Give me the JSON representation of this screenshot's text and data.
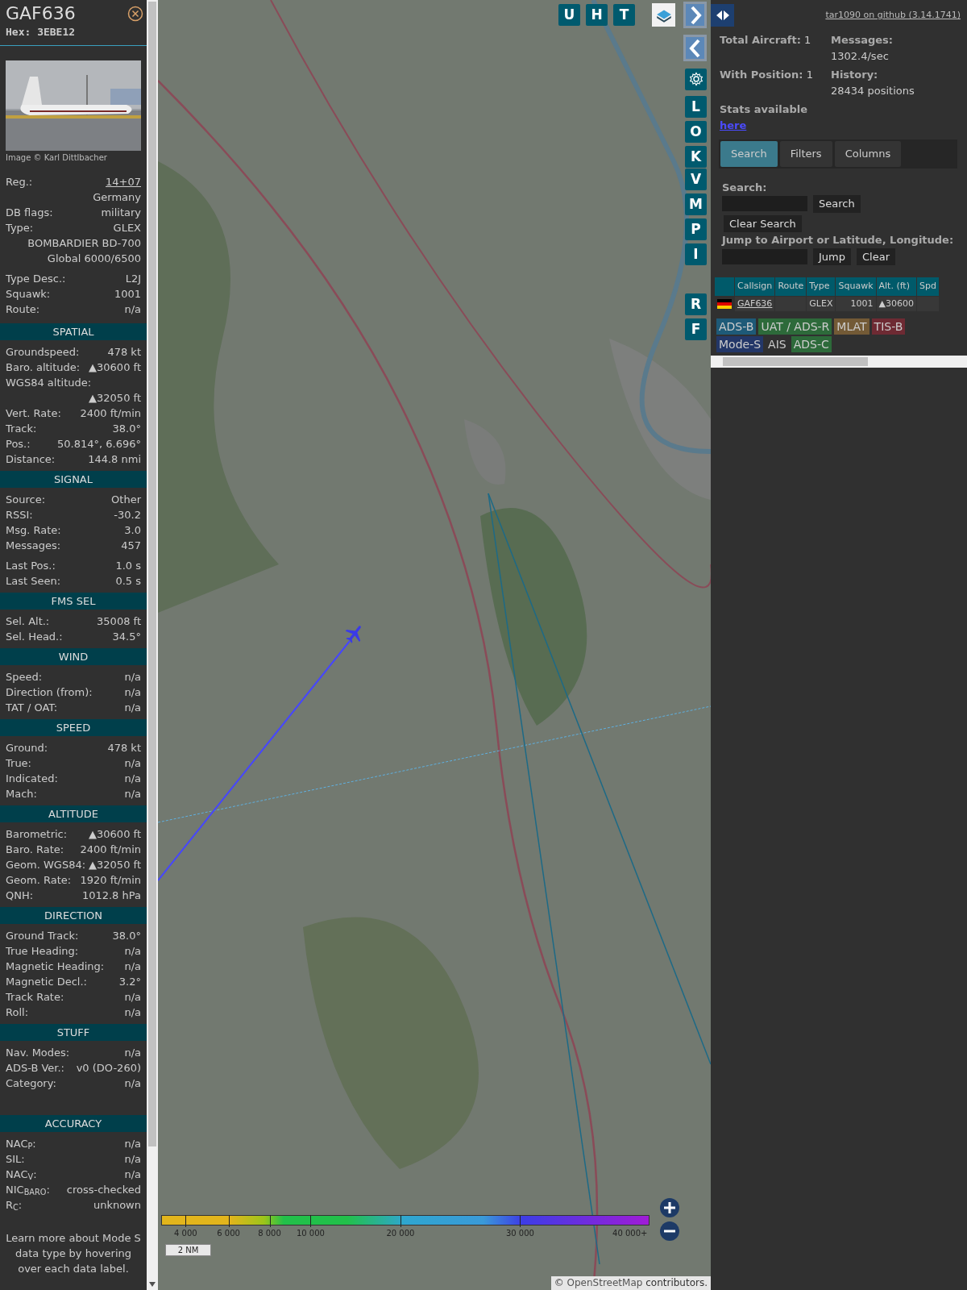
{
  "sidebar": {
    "callsign": "GAF636",
    "hex_label": "Hex:",
    "hex": "3EBE12",
    "photo": {
      "kind": "picture",
      "credit": "Image © Karl Dittlbacher"
    },
    "details": [
      [
        {
          "kind": "pair",
          "label": "Reg.:",
          "value": "14+07",
          "link": true
        },
        {
          "kind": "value",
          "value": "Germany"
        },
        {
          "kind": "pair",
          "label": "DB flags:",
          "value": "military"
        },
        {
          "kind": "pair",
          "label": "Type:",
          "value": "GLEX"
        },
        {
          "kind": "value",
          "value": "BOMBARDIER BD-700 Global 6000/6500"
        }
      ],
      [
        {
          "kind": "pair",
          "label": "Type Desc.:",
          "value": "L2J"
        },
        {
          "kind": "pair",
          "label": "Squawk:",
          "value": "1001"
        },
        {
          "kind": "pair",
          "label": "Route:",
          "value": "n/a"
        }
      ]
    ],
    "sections": [
      {
        "title": "SPATIAL",
        "groups": [
          [
            {
              "kind": "pair",
              "label": "Groundspeed:",
              "value": "478 kt"
            },
            {
              "kind": "pair",
              "label": "Baro. altitude:",
              "value": "▲30600 ft"
            },
            {
              "kind": "wrap",
              "label": "WGS84 altitude:",
              "value": "▲32050 ft"
            },
            {
              "kind": "pair",
              "label": "Vert. Rate:",
              "value": "2400 ft/min"
            },
            {
              "kind": "pair",
              "label": "Track:",
              "value": "38.0°"
            },
            {
              "kind": "pair",
              "label": "Pos.:",
              "value": "50.814°, 6.696°"
            },
            {
              "kind": "pair",
              "label": "Distance:",
              "value": "144.8 nmi"
            }
          ]
        ]
      },
      {
        "title": "SIGNAL",
        "groups": [
          [
            {
              "kind": "pair",
              "label": "Source:",
              "value": "Other"
            },
            {
              "kind": "pair",
              "label": "RSSI:",
              "value": "-30.2"
            },
            {
              "kind": "pair",
              "label": "Msg. Rate:",
              "value": "3.0"
            },
            {
              "kind": "pair",
              "label": "Messages:",
              "value": "457"
            }
          ],
          [
            {
              "kind": "pair",
              "label": "Last Pos.:",
              "value": "1.0 s"
            },
            {
              "kind": "pair",
              "label": "Last Seen:",
              "value": "0.5 s"
            }
          ]
        ]
      },
      {
        "title": "FMS SEL",
        "groups": [
          [
            {
              "kind": "pair",
              "label": "Sel. Alt.:",
              "value": "35008 ft"
            },
            {
              "kind": "pair",
              "label": "Sel. Head.:",
              "value": "34.5°"
            }
          ]
        ]
      },
      {
        "title": "WIND",
        "groups": [
          [
            {
              "kind": "pair",
              "label": "Speed:",
              "value": "n/a"
            },
            {
              "kind": "pair",
              "label": "Direction (from):",
              "value": "n/a"
            },
            {
              "kind": "pair",
              "label": "TAT / OAT:",
              "value": "n/a"
            }
          ]
        ]
      },
      {
        "title": "SPEED",
        "groups": [
          [
            {
              "kind": "pair",
              "label": "Ground:",
              "value": "478 kt"
            },
            {
              "kind": "pair",
              "label": "True:",
              "value": "n/a"
            },
            {
              "kind": "pair",
              "label": "Indicated:",
              "value": "n/a"
            },
            {
              "kind": "pair",
              "label": "Mach:",
              "value": "n/a"
            }
          ]
        ]
      },
      {
        "title": "ALTITUDE",
        "groups": [
          [
            {
              "kind": "pair",
              "label": "Barometric:",
              "value": "▲30600 ft"
            },
            {
              "kind": "pair",
              "label": "Baro. Rate:",
              "value": "2400 ft/min"
            },
            {
              "kind": "pair",
              "label": "Geom. WGS84:",
              "value": "▲32050 ft"
            },
            {
              "kind": "pair",
              "label": "Geom. Rate:",
              "value": "1920 ft/min"
            },
            {
              "kind": "pair",
              "label": "QNH:",
              "value": "1012.8 hPa"
            }
          ]
        ]
      },
      {
        "title": "DIRECTION",
        "groups": [
          [
            {
              "kind": "pair",
              "label": "Ground Track:",
              "value": "38.0°"
            },
            {
              "kind": "pair",
              "label": "True Heading:",
              "value": "n/a"
            },
            {
              "kind": "pair",
              "label": "Magnetic Heading:",
              "value": "n/a"
            },
            {
              "kind": "pair",
              "label": "Magnetic Decl.:",
              "value": "3.2°"
            },
            {
              "kind": "pair",
              "label": "Track Rate:",
              "value": "n/a"
            },
            {
              "kind": "pair",
              "label": "Roll:",
              "value": "n/a"
            }
          ]
        ]
      },
      {
        "title": "STUFF",
        "groups": [
          [
            {
              "kind": "pair",
              "label": "Nav. Modes:",
              "value": "n/a"
            },
            {
              "kind": "pair",
              "label": "ADS-B Ver.:",
              "value": "v0 (DO-260)"
            },
            {
              "kind": "pair",
              "label": "Category:",
              "value": "n/a"
            }
          ]
        ]
      },
      {
        "title": "ACCURACY",
        "groups": [
          [
            {
              "kind": "pair",
              "label": "NAC$_{P}$:",
              "value": "n/a"
            },
            {
              "kind": "pair",
              "label": "SIL:",
              "value": "n/a"
            },
            {
              "kind": "pair",
              "label": "NAC$_{V}$:",
              "value": "n/a"
            },
            {
              "kind": "pair",
              "label": "NIC$_{BARO}$:",
              "value": "cross-checked"
            },
            {
              "kind": "pair",
              "label": "R$_{C}$:",
              "value": "unknown"
            }
          ]
        ]
      }
    ],
    "footer": "Learn more about Mode S data type by hovering over each data label."
  },
  "map": {
    "kind": "picture",
    "top_buttons": [
      "U",
      "H",
      "T"
    ],
    "side_groups": [
      [
        "L",
        "O",
        "K"
      ],
      [
        "V",
        "M",
        "P",
        "I"
      ],
      [
        "R",
        "F"
      ]
    ],
    "legend": [
      "4 000",
      "6 000",
      "8 000",
      "10 000",
      "20 000",
      "30 000",
      "40 000+"
    ],
    "scale": "2 NM",
    "attribution": {
      "prefix": "©",
      "link": "OpenStreetMap",
      "suffix": "contributors."
    }
  },
  "panel": {
    "version_link": "tar1090 on github (3.14.1741)",
    "stats": [
      {
        "label": "Total Aircraft:",
        "value": "1"
      },
      {
        "label": "Messages:",
        "value": "1302.4/sec"
      },
      {
        "label": "With Position:",
        "value": "1"
      },
      {
        "label": "History:",
        "value": "28434 positions"
      }
    ],
    "stats_note": "Stats available",
    "stats_link": "here",
    "tabs": [
      {
        "label": "Search",
        "selected": true
      },
      {
        "label": "Filters",
        "selected": false
      },
      {
        "label": "Columns",
        "selected": false
      }
    ],
    "search_label": "Search:",
    "search_button": "Search",
    "clear_search_button": "Clear Search",
    "jump_label": "Jump to Airport or Latitude, Longitude:",
    "jump_button": "Jump",
    "clear_button": "Clear",
    "table": {
      "columns": [
        "Callsign",
        "Route",
        "Type",
        "Squawk",
        "Alt. (ft)",
        "Spd"
      ],
      "rows": [
        {
          "callsign": "GAF636",
          "type": "GLEX",
          "squawk": "1001",
          "altitude": "▲30600"
        }
      ]
    },
    "sources": [
      {
        "label": "ADS-B",
        "color": "#1e5a78"
      },
      {
        "label": "UAT / ADS-R",
        "color": "#2d6a3a"
      },
      {
        "label": "MLAT",
        "color": "#735a36"
      },
      {
        "label": "TIS-B",
        "color": "#6e2a33"
      },
      {
        "label": "Mode-S",
        "color": "#233768"
      },
      {
        "label": "AIS"
      },
      {
        "label": "ADS-C",
        "color": "#2d6a3a"
      }
    ]
  }
}
